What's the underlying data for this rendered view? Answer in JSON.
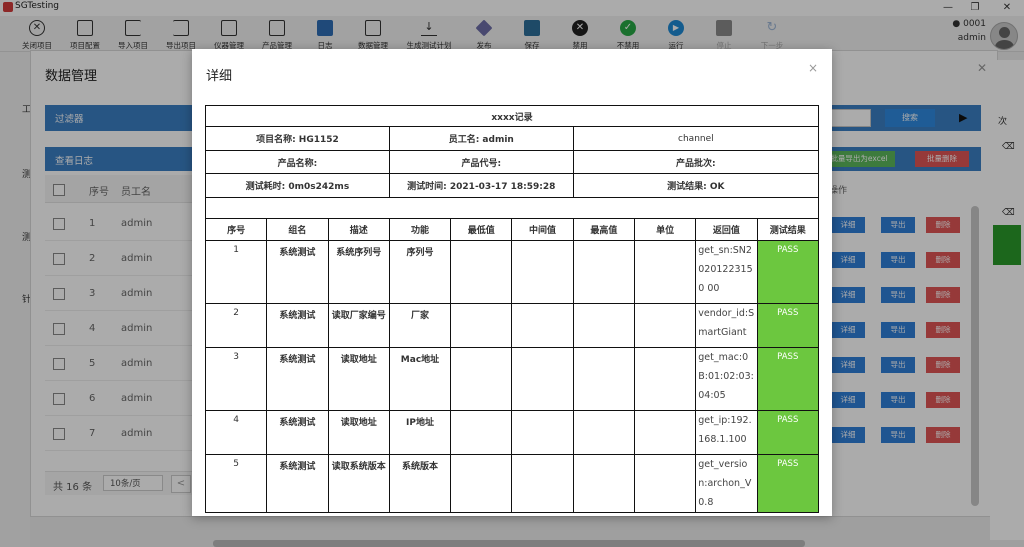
{
  "app": {
    "title": "SGTesting",
    "window_controls": [
      "—",
      "❐",
      "✕"
    ]
  },
  "toolbar": {
    "items": [
      {
        "label": "关闭项目",
        "icon": "close-circle-icon",
        "enabled": true
      },
      {
        "label": "项目配置",
        "icon": "camera-icon",
        "enabled": true
      },
      {
        "label": "导入项目",
        "icon": "import-icon",
        "enabled": true
      },
      {
        "label": "导出项目",
        "icon": "export-icon",
        "enabled": true
      },
      {
        "label": "仪器管理",
        "icon": "instrument-icon",
        "enabled": true
      },
      {
        "label": "产品管理",
        "icon": "product-icon",
        "enabled": true
      },
      {
        "label": "日志",
        "icon": "log-icon",
        "enabled": true
      },
      {
        "label": "数据管理",
        "icon": "data-icon",
        "enabled": true
      },
      {
        "label": "生成测试计划",
        "icon": "download-icon",
        "enabled": true
      },
      {
        "label": "发布",
        "icon": "layers-icon",
        "enabled": true
      },
      {
        "label": "保存",
        "icon": "save-icon",
        "enabled": true
      },
      {
        "label": "禁用",
        "icon": "disable-icon",
        "enabled": true
      },
      {
        "label": "不禁用",
        "icon": "check-icon",
        "enabled": true
      },
      {
        "label": "运行",
        "icon": "play-icon",
        "enabled": true
      },
      {
        "label": "停止",
        "icon": "stop-icon",
        "enabled": false
      },
      {
        "label": "下一步",
        "icon": "redo-icon",
        "enabled": false
      }
    ],
    "user_id": "0001",
    "user_name": "admin"
  },
  "background": {
    "title": "数据管理",
    "filter_label": "过滤器",
    "search_label": "搜索",
    "log_label": "查看日志",
    "export_excel_label": "批量导出为excel",
    "batch_delete_label": "批量删除",
    "columns": [
      "序号",
      "员工名"
    ],
    "ops_header": "操作",
    "rows": [
      {
        "num": "1",
        "name": "admin"
      },
      {
        "num": "2",
        "name": "admin"
      },
      {
        "num": "3",
        "name": "admin"
      },
      {
        "num": "4",
        "name": "admin"
      },
      {
        "num": "5",
        "name": "admin"
      },
      {
        "num": "6",
        "name": "admin"
      },
      {
        "num": "7",
        "name": "admin"
      }
    ],
    "op_labels": {
      "detail": "详细",
      "export": "导出",
      "delete": "删除"
    },
    "total": "共 16 条",
    "page_size": "10条/页",
    "prev": "<",
    "left_nav": [
      "工",
      "测",
      "测",
      "针"
    ],
    "right_edge": "次"
  },
  "modal": {
    "title": "详细",
    "close": "×",
    "record_title": "xxxx记录",
    "info": {
      "project": "项目名称: HG1152",
      "employee": "员工名: admin",
      "channel": "channel",
      "product_name": "产品名称:",
      "product_code": "产品代号:",
      "product_batch": "产品批次:",
      "duration": "测试耗时: 0m0s242ms",
      "test_time": "测试时间: 2021-03-17 18:59:28",
      "result": "测试结果: OK"
    },
    "columns": [
      "序号",
      "组名",
      "描述",
      "功能",
      "最低值",
      "中间值",
      "最高值",
      "单位",
      "返回值",
      "测试结果"
    ],
    "rows": [
      {
        "num": "1",
        "group": "系统测试",
        "desc": "系统序列号",
        "func": "序列号",
        "min": "",
        "mid": "",
        "max": "",
        "unit": "",
        "ret": "get_sn:SN20201223150 00",
        "result": "PASS"
      },
      {
        "num": "2",
        "group": "系统测试",
        "desc": "读取厂家编号",
        "func": "厂家",
        "min": "",
        "mid": "",
        "max": "",
        "unit": "",
        "ret": "vendor_id:SmartGiant",
        "result": "PASS"
      },
      {
        "num": "3",
        "group": "系统测试",
        "desc": "读取地址",
        "func": "Mac地址",
        "min": "",
        "mid": "",
        "max": "",
        "unit": "",
        "ret": "get_mac:0B:01:02:03:04:05",
        "result": "PASS"
      },
      {
        "num": "4",
        "group": "系统测试",
        "desc": "读取地址",
        "func": "IP地址",
        "min": "",
        "mid": "",
        "max": "",
        "unit": "",
        "ret": "get_ip:192.168.1.100",
        "result": "PASS"
      },
      {
        "num": "5",
        "group": "系统测试",
        "desc": "读取系统版本",
        "func": "系统版本",
        "min": "",
        "mid": "",
        "max": "",
        "unit": "",
        "ret": "get_version:archon_V0.8",
        "result": "PASS"
      }
    ]
  },
  "colors": {
    "accent": "#3b7fc4",
    "pass": "#6cc73f",
    "delete": "#e05555",
    "export_excel": "#5cb85c"
  }
}
